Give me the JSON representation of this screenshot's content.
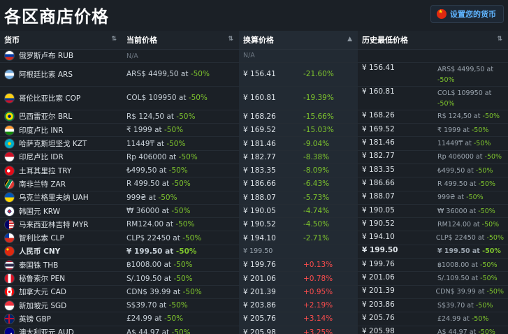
{
  "title": "各区商店价格",
  "currency_button": {
    "label": "设置您的货币",
    "icon": "cn-flag-icon"
  },
  "columns": {
    "currency": "货币",
    "current": "当前价格",
    "converted": "换算价格",
    "lowest": "历史最低价格"
  },
  "rows": [
    {
      "name": "俄罗斯卢布 RUB",
      "flag": "ru",
      "current": "N/A",
      "current_pct": "",
      "converted": "N/A",
      "diff": "",
      "hist": "",
      "hist_detail": "",
      "hist_pct": ""
    },
    {
      "name": "阿根廷比索 ARS",
      "flag": "ar",
      "current": "ARS$ 4499,50 at",
      "current_pct": "-50%",
      "converted": "¥ 156.41",
      "diff": "-21.60%",
      "hist": "¥ 156.41",
      "hist_detail": "ARS$ 4499,50 at",
      "hist_pct": "-50%"
    },
    {
      "name": "哥伦比亚比索 COP",
      "flag": "co",
      "current": "COL$ 109950 at",
      "current_pct": "-50%",
      "converted": "¥ 160.81",
      "diff": "-19.39%",
      "hist": "¥ 160.81",
      "hist_detail": "COL$ 109950 at",
      "hist_pct": "-50%"
    },
    {
      "name": "巴西雷亚尔 BRL",
      "flag": "br",
      "current": "R$ 124,50 at",
      "current_pct": "-50%",
      "converted": "¥ 168.26",
      "diff": "-15.66%",
      "hist": "¥ 168.26",
      "hist_detail": "R$ 124,50 at",
      "hist_pct": "-50%"
    },
    {
      "name": "印度卢比 INR",
      "flag": "in",
      "current": "₹ 1999 at",
      "current_pct": "-50%",
      "converted": "¥ 169.52",
      "diff": "-15.03%",
      "hist": "¥ 169.52",
      "hist_detail": "₹ 1999 at",
      "hist_pct": "-50%"
    },
    {
      "name": "哈萨克斯坦坚戈 KZT",
      "flag": "kz",
      "current": "11449₸ at",
      "current_pct": "-50%",
      "converted": "¥ 181.46",
      "diff": "-9.04%",
      "hist": "¥ 181.46",
      "hist_detail": "11449₸ at",
      "hist_pct": "-50%"
    },
    {
      "name": "印尼卢比 IDR",
      "flag": "id",
      "current": "Rp 406000 at",
      "current_pct": "-50%",
      "converted": "¥ 182.77",
      "diff": "-8.38%",
      "hist": "¥ 182.77",
      "hist_detail": "Rp 406000 at",
      "hist_pct": "-50%"
    },
    {
      "name": "土耳其里拉 TRY",
      "flag": "tr",
      "current": "₺499,50 at",
      "current_pct": "-50%",
      "converted": "¥ 183.35",
      "diff": "-8.09%",
      "hist": "¥ 183.35",
      "hist_detail": "₺499,50 at",
      "hist_pct": "-50%"
    },
    {
      "name": "南非兰特 ZAR",
      "flag": "za",
      "current": "R 499.50 at",
      "current_pct": "-50%",
      "converted": "¥ 186.66",
      "diff": "-6.43%",
      "hist": "¥ 186.66",
      "hist_detail": "R 499.50 at",
      "hist_pct": "-50%"
    },
    {
      "name": "乌克兰格里夫纳 UAH",
      "flag": "ua",
      "current": "999₴ at",
      "current_pct": "-50%",
      "converted": "¥ 188.07",
      "diff": "-5.73%",
      "hist": "¥ 188.07",
      "hist_detail": "999₴ at",
      "hist_pct": "-50%"
    },
    {
      "name": "韩国元 KRW",
      "flag": "kr",
      "current": "₩ 36000 at",
      "current_pct": "-50%",
      "converted": "¥ 190.05",
      "diff": "-4.74%",
      "hist": "¥ 190.05",
      "hist_detail": "₩ 36000 at",
      "hist_pct": "-50%"
    },
    {
      "name": "马来西亚林吉特 MYR",
      "flag": "my",
      "current": "RM124.00 at",
      "current_pct": "-50%",
      "converted": "¥ 190.52",
      "diff": "-4.50%",
      "hist": "¥ 190.52",
      "hist_detail": "RM124.00 at",
      "hist_pct": "-50%"
    },
    {
      "name": "智利比索 CLP",
      "flag": "cl",
      "current": "CLP$ 22450 at",
      "current_pct": "-50%",
      "converted": "¥ 194.10",
      "diff": "-2.71%",
      "hist": "¥ 194.10",
      "hist_detail": "CLP$ 22450 at",
      "hist_pct": "-50%"
    },
    {
      "name": "人民币 CNY",
      "flag": "cn",
      "current": "¥ 199.50 at",
      "current_pct": "-50%",
      "converted": "¥ 199.50",
      "diff": "",
      "hist": "¥ 199.50",
      "hist_detail": "¥ 199.50 at",
      "hist_pct": "-50%"
    },
    {
      "name": "泰国铢 THB",
      "flag": "th",
      "current": "฿1008.00 at",
      "current_pct": "-50%",
      "converted": "¥ 199.76",
      "diff": "+0.13%",
      "hist": "¥ 199.76",
      "hist_detail": "฿1008.00 at",
      "hist_pct": "-50%"
    },
    {
      "name": "秘鲁索尔 PEN",
      "flag": "pe",
      "current": "S/.109.50 at",
      "current_pct": "-50%",
      "converted": "¥ 201.06",
      "diff": "+0.78%",
      "hist": "¥ 201.06",
      "hist_detail": "S/.109.50 at",
      "hist_pct": "-50%"
    },
    {
      "name": "加拿大元 CAD",
      "flag": "ca",
      "current": "CDN$ 39.99 at",
      "current_pct": "-50%",
      "converted": "¥ 201.39",
      "diff": "+0.95%",
      "hist": "¥ 201.39",
      "hist_detail": "CDN$ 39.99 at",
      "hist_pct": "-50%"
    },
    {
      "name": "新加坡元 SGD",
      "flag": "sg",
      "current": "S$39.70 at",
      "current_pct": "-50%",
      "converted": "¥ 203.86",
      "diff": "+2.19%",
      "hist": "¥ 203.86",
      "hist_detail": "S$39.70 at",
      "hist_pct": "-50%"
    },
    {
      "name": "英镑 GBP",
      "flag": "gb",
      "current": "£24.99 at",
      "current_pct": "-50%",
      "converted": "¥ 205.76",
      "diff": "+3.14%",
      "hist": "¥ 205.76",
      "hist_detail": "£24.99 at",
      "hist_pct": "-50%"
    },
    {
      "name": "澳大利亚元 AUD",
      "flag": "au",
      "current": "A$ 44.97 at",
      "current_pct": "-50%",
      "converted": "¥ 205.98",
      "diff": "+3.25%",
      "hist": "¥ 205.98",
      "hist_detail": "A$ 44.97 at",
      "hist_pct": "-50%"
    }
  ],
  "colors": {
    "green": "#7ec42d",
    "red": "#ff4d4d",
    "link": "#5fb4ff"
  }
}
